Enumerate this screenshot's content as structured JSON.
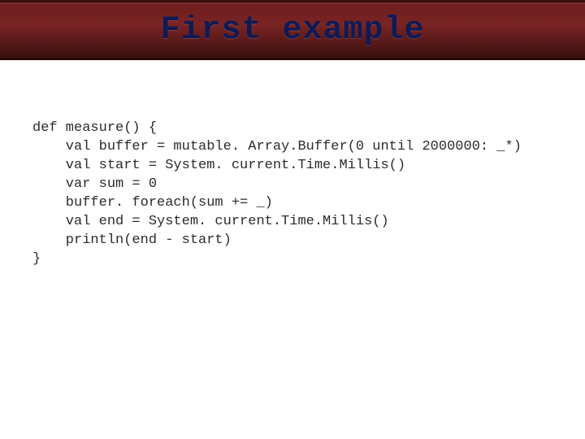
{
  "slide": {
    "title": "First example"
  },
  "code": {
    "lines": [
      "def measure() {",
      "    val buffer = mutable. Array.Buffer(0 until 2000000: _*)",
      "    val start = System. current.Time.Millis()",
      "    var sum = 0",
      "    buffer. foreach(sum += _)",
      "    val end = System. current.Time.Millis()",
      "    println(end - start)",
      "}"
    ]
  }
}
